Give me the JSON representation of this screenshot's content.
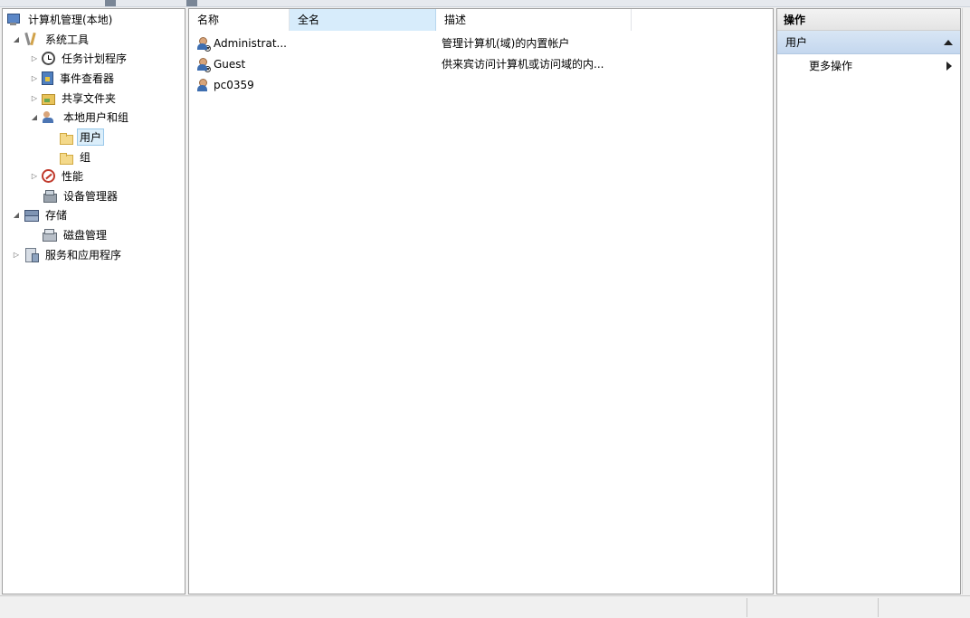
{
  "tree": {
    "root": "计算机管理(本地)",
    "system_tools": "系统工具",
    "task_scheduler": "任务计划程序",
    "event_viewer": "事件查看器",
    "shared_folders": "共享文件夹",
    "local_users_groups": "本地用户和组",
    "users": "用户",
    "groups": "组",
    "performance": "性能",
    "device_manager": "设备管理器",
    "storage": "存储",
    "disk_management": "磁盘管理",
    "services_apps": "服务和应用程序"
  },
  "list": {
    "columns": [
      "名称",
      "全名",
      "描述"
    ],
    "rows": [
      {
        "name": "Administrat...",
        "fullname": "",
        "desc": "管理计算机(域)的内置帐户",
        "icon": "user-disabled-icon"
      },
      {
        "name": "Guest",
        "fullname": "",
        "desc": "供来宾访问计算机或访问域的内...",
        "icon": "user-disabled-icon"
      },
      {
        "name": "pc0359",
        "fullname": "",
        "desc": "",
        "icon": "user-icon"
      }
    ]
  },
  "actions": {
    "title": "操作",
    "section": "用户",
    "more": "更多操作"
  }
}
